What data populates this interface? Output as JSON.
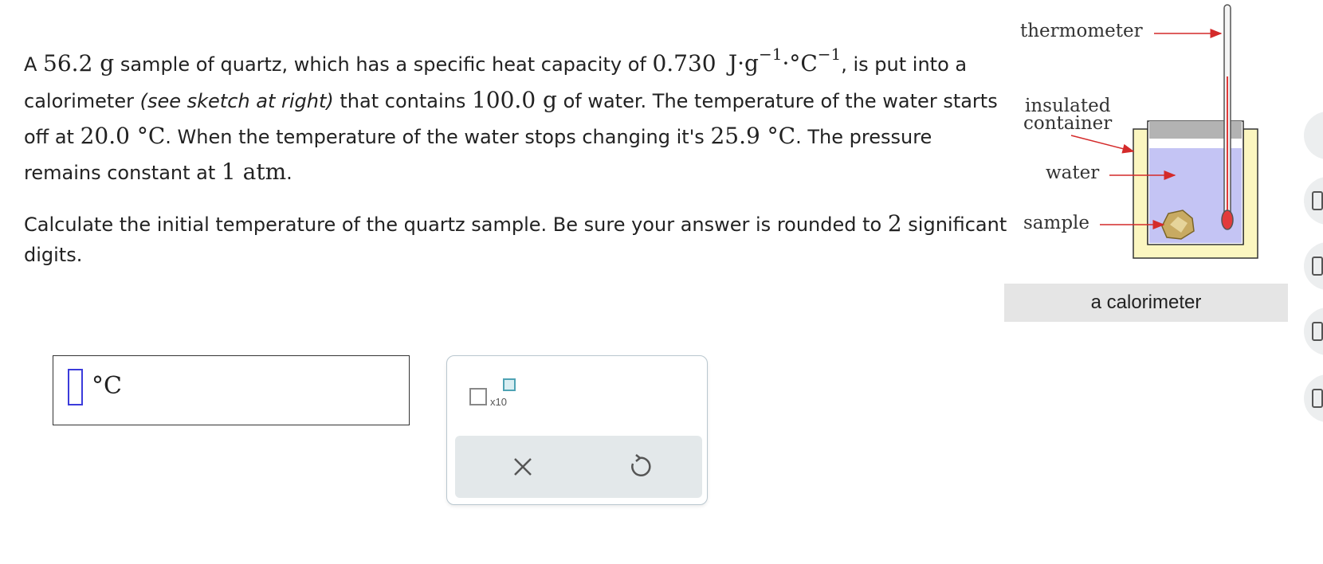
{
  "question": {
    "p1": {
      "t1": "A ",
      "mass": "56.2 g",
      "t2": " sample of quartz, which has a specific heat capacity of ",
      "c_val": "0.730",
      "c_j": "J·g",
      "c_exp1": "−1",
      "c_deg": "·°C",
      "c_exp2": "−1",
      "t3": ", is put into a calorimeter ",
      "italic": "(see sketch at right)",
      "t4": " that contains ",
      "water_mass": "100.0 g",
      "t5": " of water. The temperature of the water starts off at ",
      "t_start": "20.0 °C",
      "t6": ". When the temperature of the water stops changing it's ",
      "t_end": "25.9 °C",
      "t7": ". The pressure remains constant at ",
      "pressure": "1 atm",
      "t8": "."
    },
    "p2": {
      "t1": "Calculate the initial temperature of the quartz sample. Be sure your answer is rounded to ",
      "digits": "2",
      "t2": " significant digits."
    }
  },
  "answer": {
    "value": "",
    "unit": "°C"
  },
  "keypad": {
    "sci_label": "x10",
    "clear_icon": "close-icon",
    "undo_icon": "undo-icon"
  },
  "sketch": {
    "thermometer": "thermometer",
    "insulated_line1": "insulated",
    "insulated_line2": "container",
    "water": "water",
    "sample": "sample",
    "caption": "a calorimeter"
  },
  "colors": {
    "arrow": "#d42a2a",
    "water": "#c4c4f4",
    "container": "#fbf6c0",
    "answer_cursor": "#3b3bdb",
    "action_bar": "#e3e8ea"
  }
}
